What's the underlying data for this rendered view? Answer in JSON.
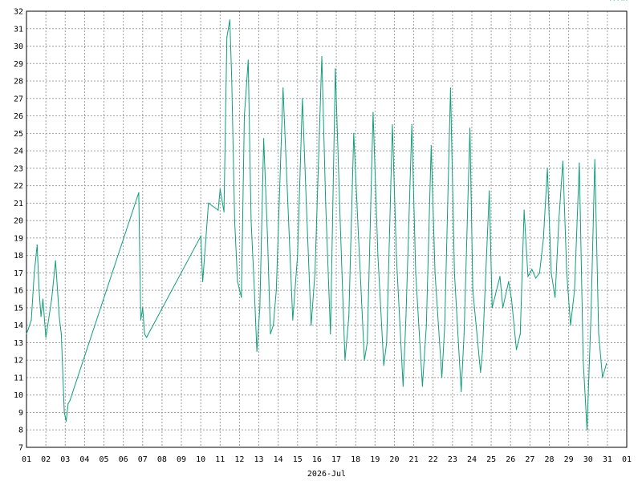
{
  "chart_data": {
    "type": "line",
    "title": "",
    "xlabel": "2026-Jul",
    "ylabel": "",
    "ylim": [
      7,
      32
    ],
    "xlim": [
      1,
      32
    ],
    "grid": true,
    "line_color": "#109e7c",
    "y_ticks": [
      7,
      8,
      9,
      10,
      11,
      12,
      13,
      14,
      15,
      16,
      17,
      18,
      19,
      20,
      21,
      22,
      23,
      24,
      25,
      26,
      27,
      28,
      29,
      30,
      31,
      32
    ],
    "x_ticks": [
      {
        "v": 1,
        "label": "01"
      },
      {
        "v": 2,
        "label": "02"
      },
      {
        "v": 3,
        "label": "03"
      },
      {
        "v": 4,
        "label": "04"
      },
      {
        "v": 5,
        "label": "05"
      },
      {
        "v": 6,
        "label": "06"
      },
      {
        "v": 7,
        "label": "07"
      },
      {
        "v": 8,
        "label": "08"
      },
      {
        "v": 9,
        "label": "09"
      },
      {
        "v": 10,
        "label": "10"
      },
      {
        "v": 11,
        "label": "11"
      },
      {
        "v": 12,
        "label": "12"
      },
      {
        "v": 13,
        "label": "13"
      },
      {
        "v": 14,
        "label": "14"
      },
      {
        "v": 15,
        "label": "15"
      },
      {
        "v": 16,
        "label": "16"
      },
      {
        "v": 17,
        "label": "17"
      },
      {
        "v": 18,
        "label": "18"
      },
      {
        "v": 19,
        "label": "19"
      },
      {
        "v": 20,
        "label": "20"
      },
      {
        "v": 21,
        "label": "21"
      },
      {
        "v": 22,
        "label": "22"
      },
      {
        "v": 23,
        "label": "23"
      },
      {
        "v": 24,
        "label": "24"
      },
      {
        "v": 25,
        "label": "25"
      },
      {
        "v": 26,
        "label": "26"
      },
      {
        "v": 27,
        "label": "27"
      },
      {
        "v": 28,
        "label": "28"
      },
      {
        "v": 29,
        "label": "29"
      },
      {
        "v": 30,
        "label": "30"
      },
      {
        "v": 31,
        "label": "31"
      },
      {
        "v": 32,
        "label": "01"
      }
    ],
    "x": [
      1.0,
      1.1,
      1.25,
      1.4,
      1.55,
      1.65,
      1.75,
      1.85,
      2.0,
      2.1,
      2.3,
      2.5,
      2.7,
      2.8,
      2.95,
      3.05,
      3.15,
      3.25,
      6.8,
      6.9,
      7.0,
      7.1,
      7.2,
      10.0,
      10.1,
      10.2,
      10.4,
      10.9,
      11.0,
      11.2,
      11.35,
      11.5,
      11.6,
      11.75,
      11.9,
      12.1,
      12.25,
      12.45,
      12.6,
      12.75,
      12.9,
      13.05,
      13.25,
      13.45,
      13.6,
      13.75,
      13.9,
      14.25,
      14.5,
      14.75,
      15.0,
      15.25,
      15.45,
      15.7,
      15.9,
      16.25,
      16.45,
      16.7,
      16.95,
      17.2,
      17.45,
      17.65,
      17.9,
      18.15,
      18.45,
      18.6,
      18.9,
      19.15,
      19.45,
      19.6,
      19.9,
      20.1,
      20.45,
      20.6,
      20.9,
      21.1,
      21.45,
      21.65,
      21.9,
      22.1,
      22.45,
      22.6,
      22.9,
      23.1,
      23.45,
      23.6,
      23.9,
      24.05,
      24.45,
      24.55,
      24.9,
      25.05,
      25.45,
      25.6,
      25.9,
      26.05,
      26.3,
      26.5,
      26.7,
      26.9,
      27.1,
      27.3,
      27.5,
      27.7,
      27.9,
      28.1,
      28.3,
      28.5,
      28.7,
      28.9,
      29.1,
      29.3,
      29.55,
      29.75,
      29.95,
      30.15,
      30.35,
      30.55,
      30.75,
      30.95,
      31.15,
      31.35,
      31.55,
      31.75,
      31.85,
      32.0
    ],
    "y": [
      13.5,
      13.8,
      14.3,
      17.0,
      18.6,
      16.0,
      14.5,
      15.5,
      13.3,
      14.0,
      15.5,
      17.7,
      14.4,
      13.5,
      9.0,
      8.5,
      9.5,
      9.7,
      21.6,
      14.3,
      15.0,
      13.5,
      13.3,
      19.1,
      16.5,
      18.0,
      21.0,
      20.6,
      21.8,
      20.5,
      30.5,
      31.5,
      28.0,
      20.0,
      16.5,
      15.6,
      26.0,
      29.2,
      20.0,
      16.5,
      12.5,
      15.0,
      24.7,
      19.0,
      13.5,
      14.0,
      16.0,
      27.6,
      21.0,
      14.3,
      18.0,
      27.0,
      21.0,
      14.0,
      17.0,
      29.4,
      21.0,
      13.5,
      28.7,
      20.0,
      12.0,
      14.5,
      25.0,
      19.0,
      12.0,
      13.0,
      26.2,
      18.0,
      11.7,
      13.0,
      25.5,
      18.0,
      10.5,
      14.5,
      25.5,
      17.0,
      10.5,
      14.0,
      24.3,
      17.0,
      11.0,
      14.0,
      27.6,
      17.0,
      10.2,
      13.5,
      25.3,
      16.0,
      11.3,
      12.5,
      21.7,
      15.0,
      16.8,
      15.0,
      16.5,
      15.5,
      12.6,
      13.5,
      20.6,
      16.8,
      17.2,
      16.7,
      17.0,
      19.0,
      23.0,
      17.0,
      15.6,
      20.1,
      23.4,
      17.0,
      14.0,
      16.0,
      23.3,
      12.0,
      8.0,
      14.5,
      23.5,
      13.5,
      11.0,
      11.8
    ]
  }
}
